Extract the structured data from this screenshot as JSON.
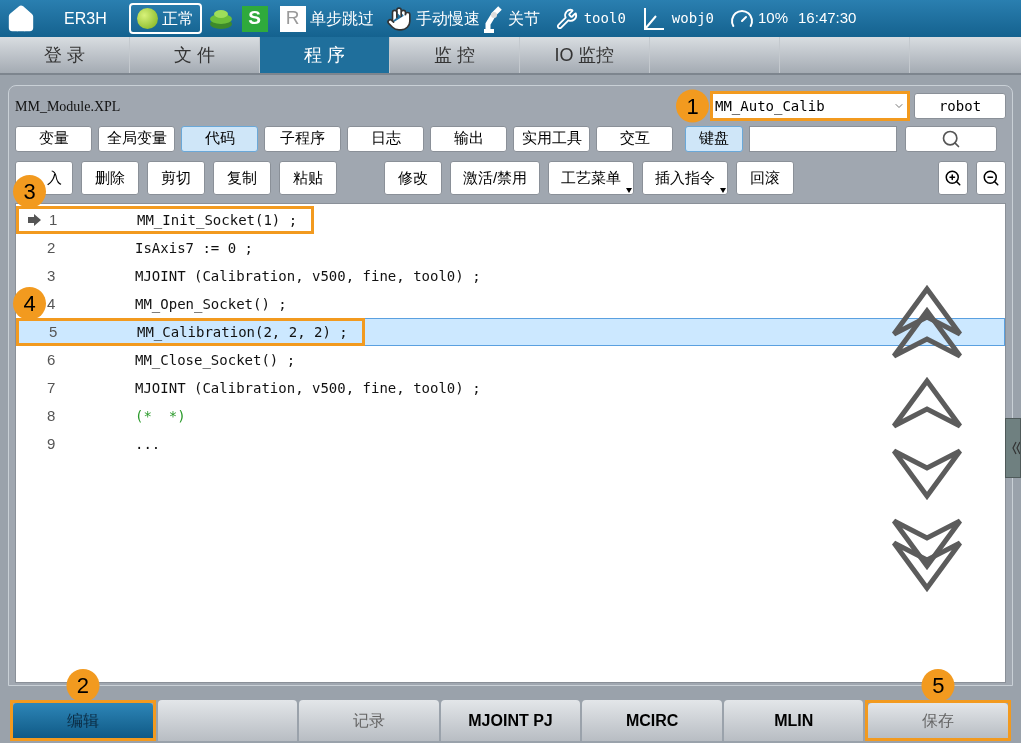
{
  "top_bar": {
    "robot": "ER3H",
    "status": "正常",
    "mode_s": "S",
    "mode_r": "R",
    "step_mode": "单步跳过",
    "speed_mode": "手动慢速",
    "coord": "关节",
    "tool": "tool0",
    "wobj": "wobj0",
    "speed": "10%",
    "time": "16:47:30"
  },
  "main_tabs": [
    {
      "label": "登 录",
      "selected": false
    },
    {
      "label": "文 件",
      "selected": false
    },
    {
      "label": "程 序",
      "selected": true
    },
    {
      "label": "监 控",
      "selected": false
    },
    {
      "label": "IO 监控",
      "selected": false
    }
  ],
  "file_name": "MM_Module.XPL",
  "module_select": {
    "value": "MM_Auto_Calib",
    "callout": {
      "number": "1"
    }
  },
  "robot_button": "robot",
  "view_buttons": [
    {
      "label": "变量",
      "selected": false
    },
    {
      "label": "全局变量",
      "selected": false
    },
    {
      "label": "代码",
      "selected": true
    },
    {
      "label": "子程序",
      "selected": false
    },
    {
      "label": "日志",
      "selected": false
    },
    {
      "label": "输出",
      "selected": false
    },
    {
      "label": "实用工具",
      "selected": false
    },
    {
      "label": "交互",
      "selected": false
    }
  ],
  "keyboard_button": {
    "label": "键盘",
    "selected": true
  },
  "edit_buttons_left": [
    {
      "label": "入",
      "dropdown": false,
      "covered": true
    },
    {
      "label": "删除",
      "dropdown": false,
      "covered": false
    },
    {
      "label": "剪切",
      "dropdown": false,
      "covered": false
    },
    {
      "label": "复制",
      "dropdown": false,
      "covered": false
    },
    {
      "label": "粘贴",
      "dropdown": false,
      "covered": false
    }
  ],
  "edit_buttons_right": [
    {
      "label": "修改",
      "dropdown": false,
      "covered": false
    },
    {
      "label": "激活/禁用",
      "dropdown": false,
      "covered": false
    },
    {
      "label": "工艺菜单",
      "dropdown": true,
      "covered": false
    },
    {
      "label": "插入指令",
      "dropdown": true,
      "covered": false
    },
    {
      "label": "回滚",
      "dropdown": false,
      "covered": false
    }
  ],
  "code_lines": [
    {
      "number": "1",
      "text": "MM_Init_Socket(1) ;",
      "kind": "code",
      "selected": false,
      "current": true,
      "callout": {
        "number": "3"
      }
    },
    {
      "number": "2",
      "text": "IsAxis7 := 0 ;",
      "kind": "code",
      "selected": false,
      "current": false
    },
    {
      "number": "3",
      "text": "MJOINT (Calibration, v500, fine, tool0) ;",
      "kind": "code",
      "selected": false,
      "current": false
    },
    {
      "number": "4",
      "text": "MM_Open_Socket() ;",
      "kind": "code",
      "selected": false,
      "current": false
    },
    {
      "number": "5",
      "text": "MM_Calibration(2, 2, 2) ;",
      "kind": "code",
      "selected": true,
      "current": false,
      "callout": {
        "number": "4"
      }
    },
    {
      "number": "6",
      "text": "MM_Close_Socket() ;",
      "kind": "code",
      "selected": false,
      "current": false
    },
    {
      "number": "7",
      "text": "MJOINT (Calibration, v500, fine, tool0) ;",
      "kind": "code",
      "selected": false,
      "current": false
    },
    {
      "number": "8",
      "text": "(*  *)",
      "kind": "comment",
      "selected": false,
      "current": false
    },
    {
      "number": "9",
      "text": "...",
      "kind": "code",
      "selected": false,
      "current": false
    }
  ],
  "bottom_buttons": [
    {
      "kind": "button",
      "label": "编辑",
      "selected": true,
      "disabled": false,
      "callout": {
        "number": "2"
      }
    },
    {
      "kind": "blank",
      "selected": false
    },
    {
      "kind": "button",
      "label": "记录",
      "selected": false,
      "disabled": true
    },
    {
      "kind": "button",
      "label": "MJOINT PJ",
      "selected": false,
      "disabled": false
    },
    {
      "kind": "button",
      "label": "MCIRC",
      "selected": false,
      "disabled": false
    },
    {
      "kind": "button",
      "label": "MLIN",
      "selected": false,
      "disabled": false
    },
    {
      "kind": "button",
      "label": "保存",
      "selected": false,
      "disabled": true,
      "callout": {
        "number": "5"
      }
    }
  ]
}
